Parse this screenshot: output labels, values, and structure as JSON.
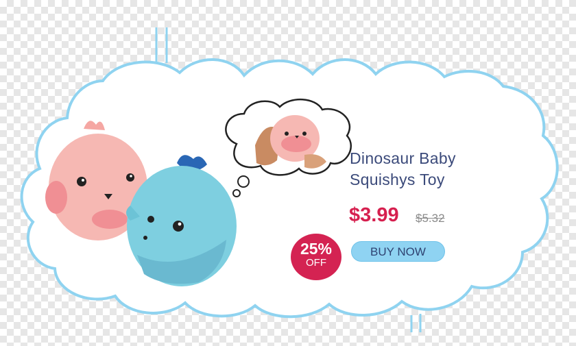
{
  "product": {
    "title_line1": "Dinosaur Baby",
    "title_line2": "Squishys Toy",
    "price": "$3.99",
    "old_price": "$5.32",
    "discount_percent": "25%",
    "discount_label": "OFF",
    "buy_label": "BUY NOW"
  },
  "colors": {
    "cloud_outline": "#8fd3f0",
    "title": "#3b4a7a",
    "price": "#d6204f",
    "badge": "#d42352",
    "button": "#8fd3f2",
    "pink_toy": "#f6b8b3",
    "blue_toy": "#7ecfe0",
    "blue_crest": "#2a67b5"
  },
  "icons": [
    "pink-dinosaur-toy-image",
    "blue-dinosaur-toy-image",
    "thought-bubble-image"
  ]
}
